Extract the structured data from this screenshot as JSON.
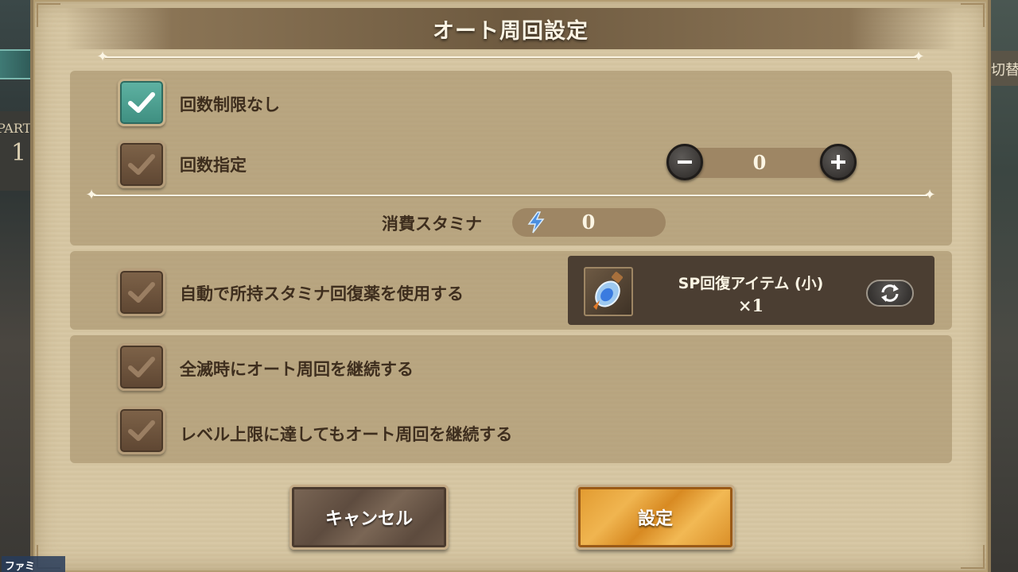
{
  "background": {
    "left_label_top": "PART",
    "left_label_num": "1",
    "right_label": "切替",
    "logo": "ファミ通.com"
  },
  "dialog": {
    "title": "オート周回設定",
    "options": {
      "unlimited": {
        "label": "回数制限なし",
        "checked": true
      },
      "specify_count": {
        "label": "回数指定",
        "checked": false,
        "value": "0"
      },
      "auto_recover": {
        "label": "自動で所持スタミナ回復薬を使用する",
        "checked": false
      },
      "continue_on_wipe": {
        "label": "全滅時にオート周回を継続する",
        "checked": false
      },
      "continue_on_level_cap": {
        "label": "レベル上限に達してもオート周回を継続する",
        "checked": false
      }
    },
    "stamina": {
      "label": "消費スタミナ",
      "value": "0"
    },
    "item": {
      "name": "SP回復アイテム (小)",
      "quantity": "×1"
    },
    "buttons": {
      "cancel": "キャンセル",
      "confirm": "設定"
    }
  },
  "colors": {
    "panel_bg": "#d8c8a5",
    "checked": "#4fa595",
    "unchecked": "#6d533d",
    "confirm": "#e9a43e",
    "cancel": "#6b5848",
    "text": "#3e2e1e"
  },
  "icons": {
    "check": "check-icon",
    "minus": "minus-icon",
    "plus": "plus-icon",
    "stamina": "lightning-icon",
    "item": "potion-icon",
    "swap": "swap-icon"
  }
}
